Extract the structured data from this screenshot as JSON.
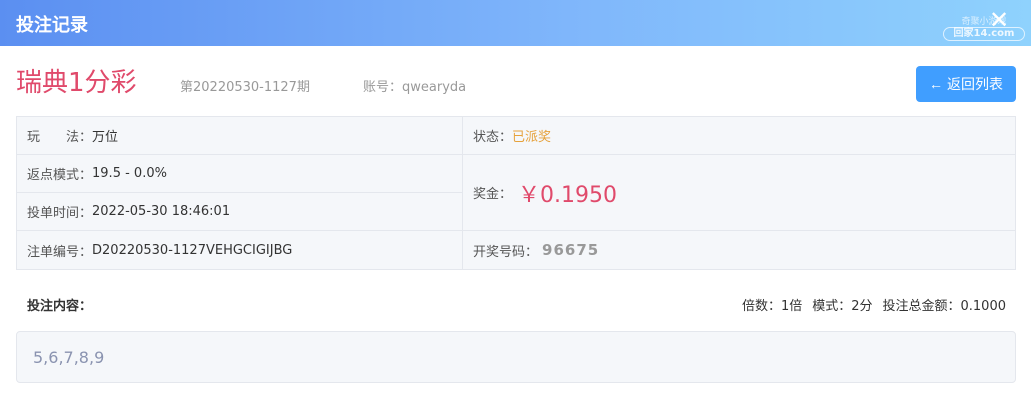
{
  "dialog": {
    "title": "投注记录",
    "close_icon": "close-icon",
    "watermark_top": "奇聚小游戏",
    "watermark_bottom": "回家14.com"
  },
  "header": {
    "game_name": "瑞典1分彩",
    "period": "第20220530-1127期",
    "account_label": "账号：",
    "account_value": "qwearyda",
    "back_button": "返回列表",
    "back_icon": "arrow-left-icon"
  },
  "info": {
    "play_label": "玩　　法：",
    "play_value": "万位",
    "status_label": "状态：",
    "status_value": "已派奖",
    "rebate_label": "返点模式：",
    "rebate_value": "19.5 - 0.0%",
    "prize_label": "奖金：",
    "prize_value": "￥0.1950",
    "bet_time_label": "投单时间：",
    "bet_time_value": "2022-05-30 18:46:01",
    "order_label": "注单编号：",
    "order_value": "D20220530-1127VEHGCIGIJBG",
    "draw_label": "开奖号码：",
    "draw_value": "96675"
  },
  "bet": {
    "content_label": "投注内容：",
    "multiplier": "倍数：1倍",
    "mode": "模式：2分",
    "total": "投注总金额：0.1000",
    "content_value": "5,6,7,8,9"
  },
  "colors": {
    "accent": "#409eff",
    "title_gradient_start": "#5b8ff1",
    "title_gradient_end": "#8fd2fd",
    "game_name": "#e04a6b",
    "status": "#e6a23c",
    "prize": "#e04a6b"
  }
}
